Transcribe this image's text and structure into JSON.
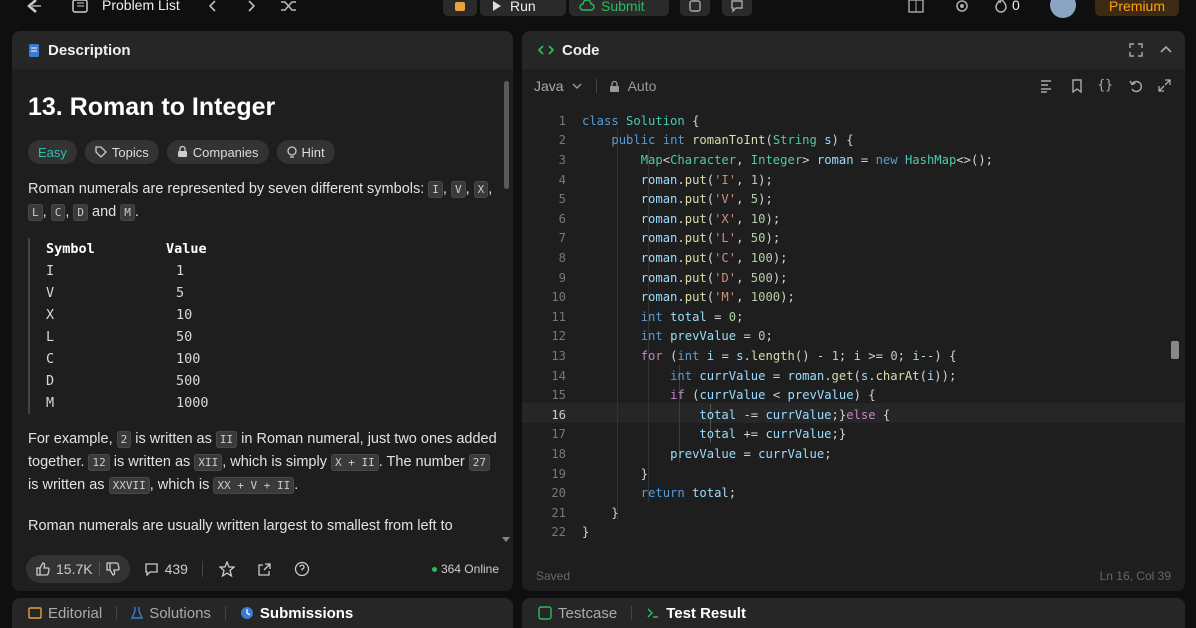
{
  "topbar": {
    "problem_list": "Problem List",
    "run": "Run",
    "submit": "Submit",
    "premium": "Premium",
    "streak": "0"
  },
  "description": {
    "tab": "Description",
    "title": "13. Roman to Integer",
    "tags": [
      "Easy",
      "Topics",
      "Companies",
      "Hint"
    ],
    "p1_before": "Roman numerals are represented by seven different symbols: ",
    "symbols_inline": [
      "I",
      "V",
      "X",
      "L",
      "C",
      "D",
      "M"
    ],
    "p1_and": "and",
    "table_header": {
      "symbol": "Symbol",
      "value": "Value"
    },
    "table_rows": [
      {
        "symbol": "I",
        "value": "1"
      },
      {
        "symbol": "V",
        "value": "5"
      },
      {
        "symbol": "X",
        "value": "10"
      },
      {
        "symbol": "L",
        "value": "50"
      },
      {
        "symbol": "C",
        "value": "100"
      },
      {
        "symbol": "D",
        "value": "500"
      },
      {
        "symbol": "M",
        "value": "1000"
      }
    ],
    "p2": {
      "t1": "For example, ",
      "c1": "2",
      "t2": " is written as ",
      "c2": "II",
      "t3": " in Roman numeral, just two ones added together. ",
      "c3": "12",
      "t4": " is written as ",
      "c4": "XII",
      "t5": ", which is simply ",
      "c5": "X + II",
      "t6": ". The number ",
      "c6": "27",
      "t7": " is written as ",
      "c7": "XXVII",
      "t8": ", which is ",
      "c8": "XX + V + II",
      "t9": "."
    },
    "p3": "Roman numerals are usually written largest to smallest from left to",
    "footer": {
      "likes": "15.7K",
      "comments": "439",
      "online": "364 Online"
    }
  },
  "code": {
    "tab": "Code",
    "language": "Java",
    "mode": "Auto",
    "status_left": "Saved",
    "status_right": "Ln 16, Col 39",
    "lines": [
      "class Solution {",
      "    public int romanToInt(String s) {",
      "        Map<Character, Integer> roman = new HashMap<>();",
      "        roman.put('I', 1);",
      "        roman.put('V', 5);",
      "        roman.put('X', 10);",
      "        roman.put('L', 50);",
      "        roman.put('C', 100);",
      "        roman.put('D', 500);",
      "        roman.put('M', 1000);",
      "        int total = 0;",
      "        int prevValue = 0;",
      "        for (int i = s.length() - 1; i >= 0; i--) {",
      "            int currValue = roman.get(s.charAt(i));",
      "            if (currValue < prevValue) {",
      "                total -= currValue;}else {",
      "                total += currValue;}",
      "            prevValue = currValue;",
      "        }",
      "        return total;",
      "    }",
      "}"
    ]
  },
  "bottom": {
    "left_tabs": [
      "Editorial",
      "Solutions",
      "Submissions"
    ],
    "right_tabs": [
      "Testcase",
      "Test Result"
    ]
  }
}
